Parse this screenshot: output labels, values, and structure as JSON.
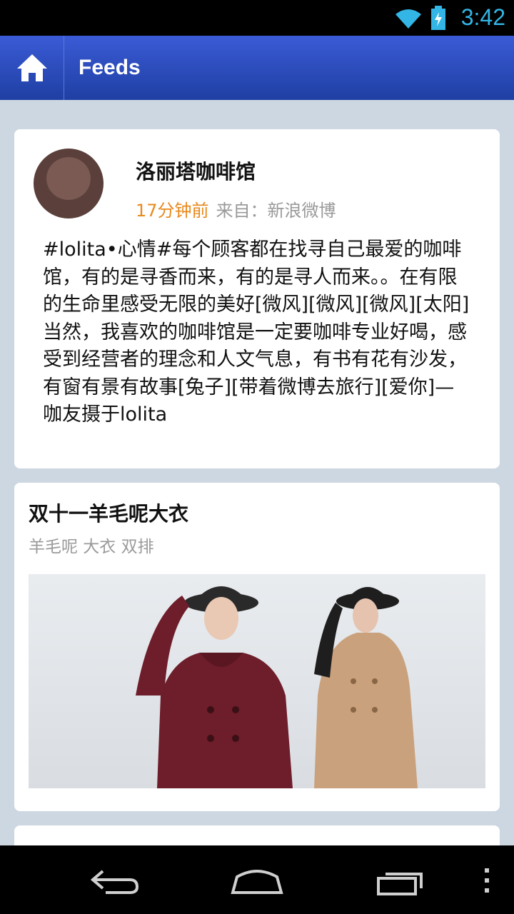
{
  "status_bar": {
    "time": "3:42"
  },
  "action_bar": {
    "title": "Feeds",
    "home_icon": "home-icon"
  },
  "feed": [
    {
      "author": "洛丽塔咖啡馆",
      "time_ago": "17分钟前",
      "source": "来自：新浪微博",
      "text": "#lolita•心情#每个顾客都在找寻自己最爱的咖啡馆，有的是寻香而来，有的是寻人而来。。在有限的生命里感受无限的美好[微风][微风][微风][太阳]当然，我喜欢的咖啡馆是一定要咖啡专业好喝，感受到经营者的理念和人文气息，有书有花有沙发，有窗有景有故事[兔子][带着微博去旅行][爱你]—咖友摄于lolita"
    },
    {
      "title": "双十一羊毛呢大衣",
      "tags": "羊毛呢 大衣 双排"
    }
  ],
  "nav_bar": {
    "icons": [
      "back-icon",
      "home-nav-icon",
      "recent-apps-icon",
      "menu-icon"
    ]
  }
}
